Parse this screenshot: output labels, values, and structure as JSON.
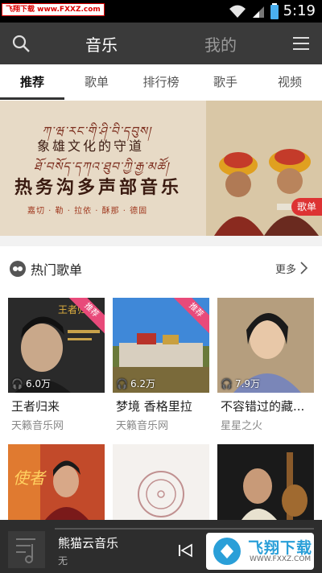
{
  "status": {
    "watermark": "飞翔下载 www.FXXZ.com",
    "time": "5:19"
  },
  "header": {
    "title": "音乐",
    "mine": "我的"
  },
  "tabs": [
    "推荐",
    "歌单",
    "排行榜",
    "歌手",
    "视频"
  ],
  "banner": {
    "line1": "ཀ་ཝ་རང་གི་ཤི་བི་དབུས།",
    "line2": "象雄文化的守道",
    "line3": "ཐོ་བསོད་དཀའ་ཐུབ་ཀྱི་རྒྱ་མཚོ།",
    "line4": "热务沟多声部音乐",
    "strip": "嘉切 · 勒 · 拉依 · 酥那 · 德固",
    "tag": "歌单"
  },
  "section": {
    "title": "热门歌单",
    "more": "更多"
  },
  "cards": [
    {
      "name": "王者归来",
      "sub": "天籁音乐网",
      "plays": "6.0万",
      "badge": "推荐",
      "cover_text": "王者归来"
    },
    {
      "name": "梦境 香格里拉",
      "sub": "天籁音乐网",
      "plays": "6.2万",
      "badge": "推荐"
    },
    {
      "name": "不容错过的藏...",
      "sub": "星星之火",
      "plays": "7.9万"
    },
    {
      "name": "",
      "sub": "",
      "plays": "",
      "cover_text": "使者"
    },
    {
      "name": "",
      "sub": "",
      "plays": ""
    },
    {
      "name": "",
      "sub": "",
      "plays": ""
    }
  ],
  "player": {
    "song": "熊猫云音乐",
    "artist": "无"
  },
  "watermark_logo": {
    "title": "飞翔下载",
    "url": "WWW.FXXZ.COM"
  },
  "colors": {
    "topbar": "#3a3a3a",
    "accent_red": "#d33333",
    "badge_pink": "#e84a7a",
    "player_bg": "#2d2d2d"
  }
}
